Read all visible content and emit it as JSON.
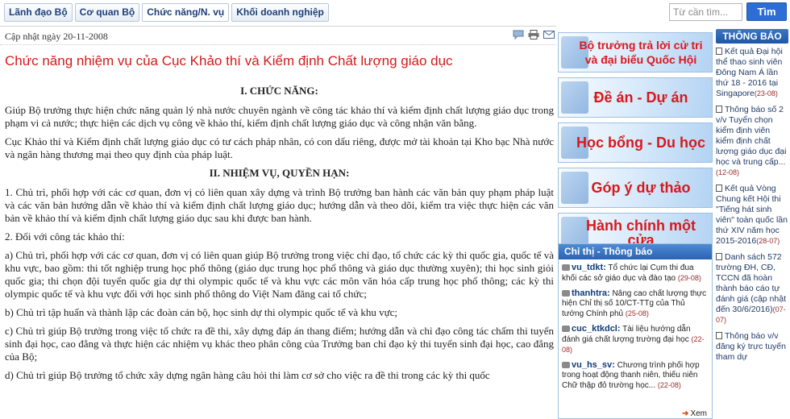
{
  "nav": {
    "tabs": [
      "Lãnh đạo Bộ",
      "Cơ quan Bộ",
      "Chức năng/N. vụ",
      "Khối doanh nghiệp"
    ],
    "search_placeholder": "Từ cần tìm...",
    "search_button": "Tìm"
  },
  "article": {
    "updated": "Cập nhật ngày 20-11-2008",
    "title": "Chức năng nhiệm vụ của Cục Khảo thí và Kiểm định Chất lượng giáo dục",
    "heading1": "I. CHỨC NĂNG:",
    "p1": "Giúp Bộ trưởng thực hiện chức năng quản lý nhà nước chuyên ngành về công tác khảo thí và kiểm định chất lượng giáo dục trong phạm vi cả nước; thực hiện các dịch vụ công về khảo thí, kiểm định chất lượng giáo dục và công nhận văn bằng.",
    "p2": "Cục Khảo thí và Kiểm định chất lượng giáo dục có tư cách pháp nhân, có con dấu riêng, được mở tài khoản tại Kho bạc Nhà nước và ngân hàng thương mại theo quy định của pháp luật.",
    "heading2": "II. NHIỆM VỤ, QUYỀN HẠN:",
    "p3": "1.    Chủ trì, phối hợp với các cơ quan, đơn vị có liên quan xây dựng và trình Bộ trưởng ban hành các văn bản quy phạm pháp luật và các văn bản hướng dẫn về khảo thí và kiểm định chất lượng giáo dục; hướng dẫn và theo dõi, kiểm tra việc thực hiện các văn bản về khảo thí và kiểm định chất lượng giáo dục sau khi được ban hành.",
    "p4": "2.    Đối với công tác khảo thí:",
    "p5": "a) Chủ trì, phối hợp với các cơ quan, đơn vị có liên quan giúp Bộ trưởng trong việc chỉ đạo, tổ chức các kỳ thi quốc gia, quốc tế và khu vực, bao gồm: thi tốt nghiệp trung học phổ thông (giáo dục trung học phổ thông và giáo dục thường xuyên); thi học sinh giỏi quốc gia; thi chọn đội tuyển quốc gia dự thi olympic quốc tế và khu vực các môn văn hóa cấp trung học phổ thông; các kỳ thi olympic quốc tế và khu vực đối với học sinh phổ thông do Việt Nam đăng cai tổ chức;",
    "p6": "b) Chủ trì tập huấn và thành lập các đoàn cán bộ, học sinh dự thi olympic quốc tế và khu vực;",
    "p7": "c) Chủ trì giúp Bộ trưởng trong việc tổ chức ra đề thi, xây dựng đáp án thang điểm; hướng dẫn và chỉ đạo công tác chấm thi tuyển sinh đại học, cao đẳng và thực hiện các nhiệm vụ khác theo phân công của Trưởng ban chỉ đạo kỳ thi tuyển sinh đại học, cao đẳng của Bộ;",
    "p8": "d) Chủ trì giúp Bộ trưởng tổ chức xây dựng ngân hàng câu hỏi thi làm cơ sở cho việc ra đề thi trong các kỳ thi quốc"
  },
  "banners": [
    {
      "text": "Bộ trưởng trả lời cử tri và đại biểu Quốc Hội",
      "size": "small"
    },
    {
      "text": "Đề án - Dự án",
      "size": "big"
    },
    {
      "text": "Học bổng - Du học",
      "size": "big"
    },
    {
      "text": "Góp ý dự thảo",
      "size": "big"
    },
    {
      "text": "Hành chính một cửa",
      "size": "big"
    }
  ],
  "notices": {
    "title": "Chỉ thị - Thông báo",
    "items": [
      {
        "user": "vu_tdkt:",
        "text": "Tổ chức lại Cụm thi đua khối các sở giáo dục và đào tạo",
        "date": "(29-08)"
      },
      {
        "user": "thanhtra:",
        "text": "Nâng cao chất lượng thực hiện Chỉ thị số 10/CT-TTg của Thủ tướng Chính phủ",
        "date": "(25-08)"
      },
      {
        "user": "cuc_ktkdcl:",
        "text": "Tài liệu hướng dẫn đánh giá chất lượng trường đại học",
        "date": "(22-08)"
      },
      {
        "user": "vu_hs_sv:",
        "text": "Chương trình phối hợp trong hoạt động thanh niên, thiếu niên Chữ thập đỏ trường học...",
        "date": "(22-08)"
      }
    ],
    "more": "Xem"
  },
  "news": {
    "title": "THÔNG BÁO",
    "items": [
      {
        "text": "Kết quả Đại hội thể thao sinh viên Đông Nam Á lần thứ 18 - 2016 tại Singapore",
        "date": "(23-08)"
      },
      {
        "text": "Thông báo số 2 v/v Tuyển chọn kiểm định viên kiểm định chất lượng giáo dục đại học và trung cấp...",
        "date": "(12-08)"
      },
      {
        "text": "Kết quả Vòng Chung kết Hội thi \"Tiếng hát sinh viên\" toàn quốc lần thứ XIV năm học 2015-2016",
        "date": "(28-07)"
      },
      {
        "text": "Danh sách 572 trường ĐH, CĐ, TCCN đã hoàn thành báo cáo tự đánh giá (cập nhật đến 30/6/2016)",
        "date": "(07-07)"
      },
      {
        "text": "Thông báo v/v đăng ký trực tuyến tham dự",
        "date": ""
      }
    ]
  },
  "colors": {
    "title_red": "#d21b1b",
    "nav_blue": "#1b3f7a",
    "accent_blue": "#2c6ed4"
  }
}
